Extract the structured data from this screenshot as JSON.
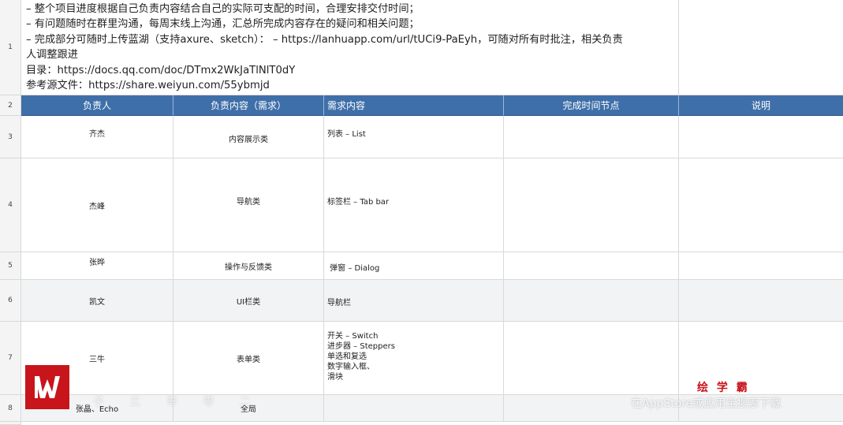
{
  "intro": {
    "lines": [
      "– 整个项目进度根据自己负责内容结合自己的实际可支配的时间，合理安排交付时间；",
      "– 有问题随时在群里沟通，每周末线上沟通，汇总所完成内容存在的疑问和相关问题；",
      "– 完成部分可随时上传蓝湖（支持axure、sketch）： – https://lanhuapp.com/url/tUCi9-PaEyh，可随对所有时批注，相关负责",
      "人调整跟进",
      "目录：https://docs.qq.com/doc/DTmx2WkJaTlNlT0dY",
      "参考源文件：https://share.weiyun.com/55ybmjd"
    ]
  },
  "row_numbers": [
    "1",
    "2",
    "3",
    "4",
    "5",
    "6",
    "7",
    "8"
  ],
  "table": {
    "headers": [
      "负责人",
      "负责内容（需求）",
      "需求内容",
      "完成时间节点",
      "说明"
    ],
    "rows": [
      {
        "owner": "齐杰",
        "category": "内容展示类",
        "requirements": [
          "列表 – List"
        ]
      },
      {
        "owner": "杰峰",
        "category": "导航类",
        "requirements": [
          "标签栏 – Tab bar"
        ]
      },
      {
        "owner": "张晔",
        "category": "操作与反馈类",
        "requirements": [
          " 弹窗 – Dialog"
        ]
      },
      {
        "owner": "凯文",
        "category": "UI栏类",
        "requirements": [
          "导航栏"
        ]
      },
      {
        "owner": "三牛",
        "category": "表单类",
        "requirements": [
          "开关 – Switch",
          "进步器 – Steppers",
          "单选和复选",
          "数字输入框、",
          "滑块"
        ]
      },
      {
        "owner": "张晶、Echo",
        "category": "全局",
        "requirements": []
      }
    ]
  },
  "overlay": {
    "brand_text": "绘 学 霸",
    "watermark_left": "子 三 零 零 二",
    "watermark_right": "在AppStore或应用宝搜索下载",
    "logo_color": "#c8141b",
    "header_color": "#3f6fa9"
  }
}
